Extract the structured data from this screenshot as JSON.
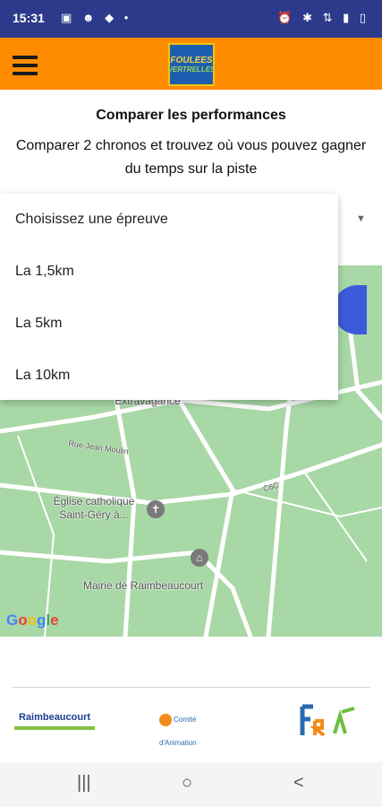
{
  "status": {
    "time": "15:31",
    "left_icons": "▣ ☻ ◆ •",
    "right_icons": "⏰ ✱ ⇅ ▮ ▯"
  },
  "header": {
    "logo_line1": "FOULEES",
    "logo_line2": "VERTRELLES"
  },
  "page": {
    "title": "Comparer les performances",
    "subtitle": "Comparer 2 chronos et trouvez où vous pouvez gagner du temps sur la piste"
  },
  "dropdown": {
    "options": [
      "Choisissez une épreuve",
      "La 1,5km",
      "La 5km",
      "La 10km"
    ]
  },
  "map": {
    "labels": {
      "extravagance": "Extravagance",
      "street": "Rue Jean Moulin",
      "road": "C6C",
      "church": "Église catholique\nSaint-Géry à...",
      "mairie": "Mairie de Raimbeaucourt"
    },
    "attribution": "Google"
  },
  "sponsors": {
    "raimbeaucourt": "Raimbeaucourt",
    "comite": "Comité d'Animation"
  },
  "nav": {
    "recent": "|||",
    "home": "○",
    "back": "<"
  }
}
